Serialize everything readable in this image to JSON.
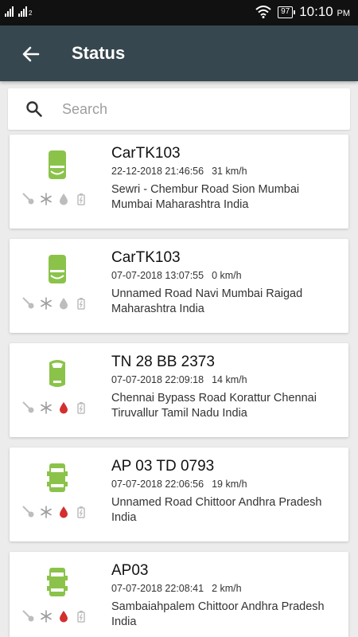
{
  "status_bar": {
    "sim_tag": "2",
    "battery": "97",
    "time": "10:10",
    "ampm": "PM"
  },
  "app_bar": {
    "title": "Status",
    "back_icon": "arrow-back-icon"
  },
  "search": {
    "placeholder": "Search",
    "value": "",
    "icon": "search-icon"
  },
  "icon_names": [
    "car-icon",
    "key-icon",
    "snowflake-icon",
    "fuel-drop-icon",
    "battery-icon"
  ],
  "colors": {
    "app_bar": "#37474f",
    "car_green": "#8bc34a",
    "indicator_grey": "#bdbdbd",
    "fuel_red": "#d32f2f"
  },
  "vehicles": [
    {
      "name": "CarTK103",
      "datetime": "22-12-2018 21:46:56",
      "speed": "31 km/h",
      "address": "Sewri - Chembur Road Sion Mumbai Mumbai Maharashtra India",
      "fuel_alert": false
    },
    {
      "name": "CarTK103",
      "datetime": "07-07-2018 13:07:55",
      "speed": "0 km/h",
      "address": "Unnamed Road Navi Mumbai Raigad Maharashtra India",
      "fuel_alert": false
    },
    {
      "name": "TN 28 BB 2373",
      "datetime": "07-07-2018 22:09:18",
      "speed": "14 km/h",
      "address": "Chennai Bypass Road Korattur Chennai Tiruvallur Tamil Nadu India",
      "fuel_alert": true
    },
    {
      "name": "AP 03 TD 0793",
      "datetime": "07-07-2018 22:06:56",
      "speed": "19 km/h",
      "address": "Unnamed Road Chittoor Andhra Pradesh India",
      "fuel_alert": true
    },
    {
      "name": "AP03",
      "datetime": "07-07-2018 22:08:41",
      "speed": "2 km/h",
      "address": "Sambaiahpalem Chittoor Andhra Pradesh India",
      "fuel_alert": true
    }
  ]
}
